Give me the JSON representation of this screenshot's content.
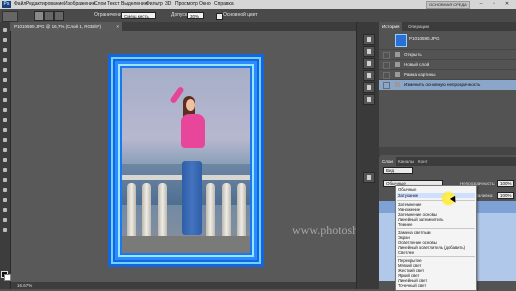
{
  "menubar": {
    "app_logo": "Ps",
    "items": [
      "Файл",
      "Редактирование",
      "Изображение",
      "Слои",
      "Текст",
      "Выделение",
      "Фильтр",
      "3D",
      "Просмотр",
      "Окно",
      "Справка"
    ],
    "workspace_btn": "ОСНОВНАЯ СРЕДА",
    "win_controls": [
      "–",
      "▫",
      "✕"
    ]
  },
  "optbar": {
    "mode_label": "Ограничение:",
    "mode_value": "Смеш.кисть",
    "radius_label": "Допуск:",
    "radius_value": "30%",
    "main_color_label": "Основной цвет"
  },
  "document": {
    "tab_title": "P1010590.JPG @ 16,7% (Слой 1, RGB/8*)",
    "close_glyph": "×",
    "zoom": "16.67%"
  },
  "watermark": "www.photoshopsunduchok.ru",
  "history": {
    "tabs": [
      "История",
      "Операции"
    ],
    "snapshot_label": "P1010590.JPG",
    "steps": [
      {
        "label": "Открыть",
        "selected": false
      },
      {
        "label": "Новый слой",
        "selected": false
      },
      {
        "label": "Рамка картины",
        "selected": false
      },
      {
        "label": "Изменить основную непрозрачность",
        "selected": true
      }
    ]
  },
  "layers": {
    "tabs": [
      "Слои",
      "Каналы",
      "Конт"
    ],
    "kind_label": "Вид",
    "blend_value": "Обычные",
    "opacity_label": "Непрозрачность:",
    "opacity_value": "100%",
    "fill_label": "Заливка:",
    "fill_value": "100%"
  },
  "blend_modes": {
    "groups": [
      [
        "Обычные",
        "Затухание"
      ],
      [
        "Затемнение",
        "Умножение",
        "Затемнение основы",
        "Линейный затемнитель",
        "Темнее"
      ],
      [
        "Замена светлым",
        "Экран",
        "Осветление основы",
        "Линейный осветлитель (добавить)",
        "Светлее"
      ],
      [
        "Перекрытие",
        "Мягкий свет",
        "Жесткий свет",
        "Яркий свет",
        "Линейный свет",
        "Точечный свет"
      ]
    ],
    "highlighted": "Затухание"
  },
  "colors": {
    "frame_blue": "#1565e0",
    "history_selected": "#8aa6c8",
    "layer_selected": "#7ea2d6"
  }
}
